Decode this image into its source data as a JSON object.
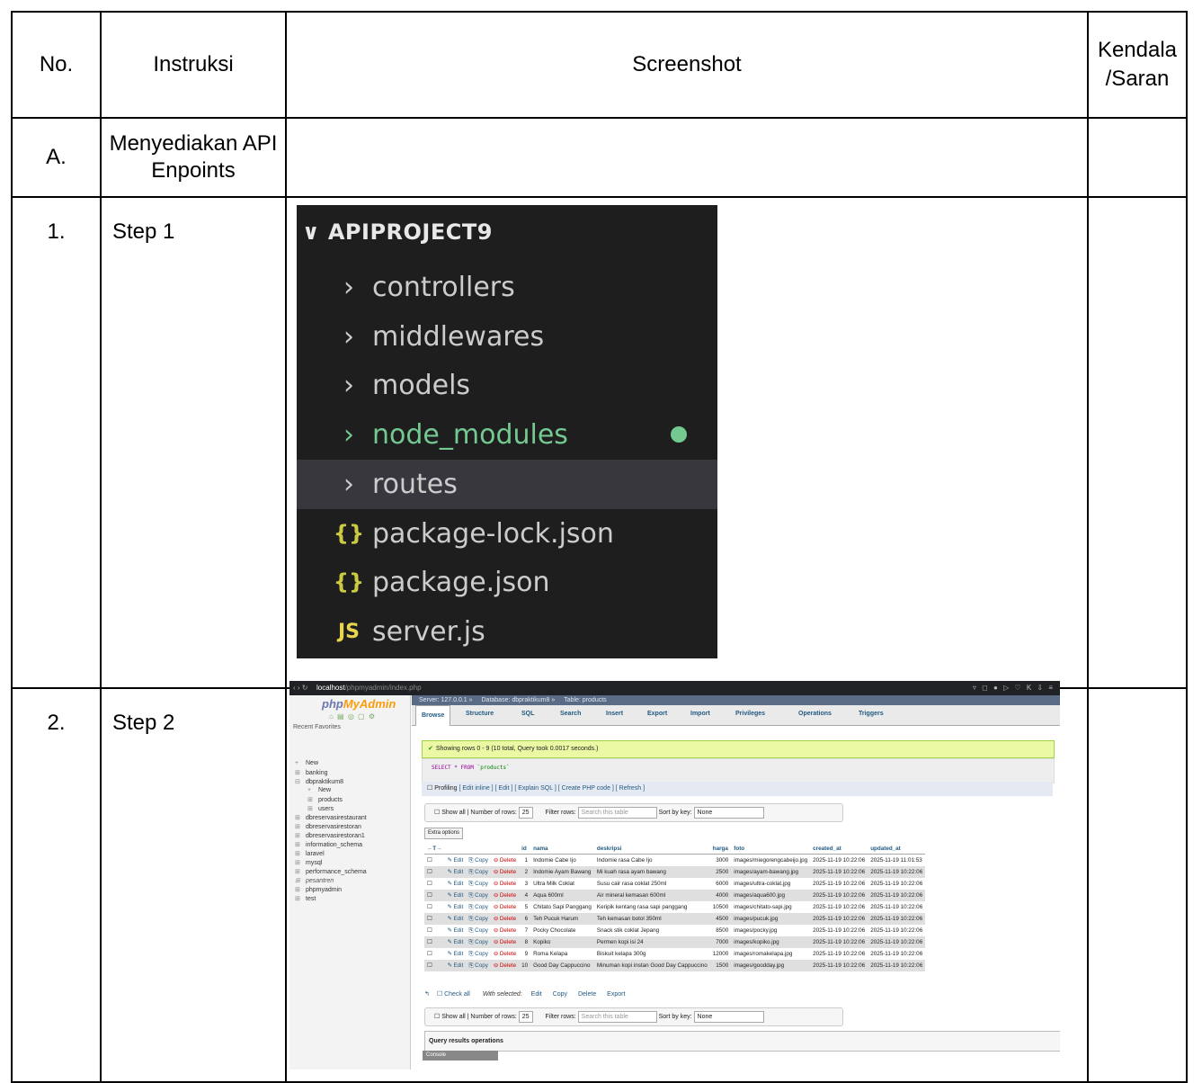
{
  "table": {
    "headers": {
      "no": "No.",
      "instruksi": "Instruksi",
      "screenshot": "Screenshot",
      "kendala_1": "Kendala",
      "kendala_2": "/Saran"
    },
    "section": {
      "no": "A.",
      "instruksi": "Menyediakan API Enpoints"
    },
    "rows": [
      {
        "no": "1.",
        "instruksi": "Step 1"
      },
      {
        "no": "2.",
        "instruksi": "Step 2"
      }
    ]
  },
  "explorer": {
    "project": "APIPROJECT9",
    "items": [
      {
        "name": "controllers",
        "icon": "chevron-right-icon"
      },
      {
        "name": "middlewares",
        "icon": "chevron-right-icon"
      },
      {
        "name": "models",
        "icon": "chevron-right-icon"
      },
      {
        "name": "node_modules",
        "icon": "chevron-right-icon",
        "color": "#73c991"
      },
      {
        "name": "routes",
        "icon": "chevron-right-icon",
        "selected": true
      },
      {
        "name": "package-lock.json",
        "icon": "json-icon"
      },
      {
        "name": "package.json",
        "icon": "json-icon"
      },
      {
        "name": "server.js",
        "icon": "js-icon"
      }
    ],
    "glyphs": {
      "chevron": "›",
      "json": "{}",
      "js": "JS",
      "down": "∨"
    }
  },
  "pma": {
    "url_host": "localhost",
    "url_path": "/phpmyadmin/index.php",
    "logo_a": "php",
    "logo_b": "MyAdmin",
    "side_tabs": "Recent  Favorites",
    "databases": [
      "New",
      "banking",
      "dbpraktikum8",
      "New",
      "products",
      "users",
      "dbreservasirestaurant",
      "dbreservasirestoran",
      "dbreservasirestoran1",
      "information_schema",
      "laravel",
      "mysql",
      "performance_schema",
      "pesantren",
      "phpmyadmin",
      "test"
    ],
    "breadcrumb": [
      "Server: 127.0.0.1",
      "Database: dbpraktikum8",
      "Table: products"
    ],
    "tabs": [
      "Browse",
      "Structure",
      "SQL",
      "Search",
      "Insert",
      "Export",
      "Import",
      "Privileges",
      "Operations",
      "Triggers"
    ],
    "success": "Showing rows 0 - 9 (10 total, Query took 0.0017 seconds.)",
    "sql_kw": "SELECT * FROM",
    "sql_table": "`products`",
    "profiling": "Profiling",
    "profiling_links": "[ Edit inline ] [ Edit ] [ Explain SQL ] [ Create PHP code ] [ Refresh ]",
    "nav": {
      "show_all": "Show all",
      "num_rows": "Number of rows:",
      "num_val": "25",
      "filter": "Filter rows:",
      "filter_ph": "Search this table",
      "sort": "Sort by key:",
      "sort_val": "None"
    },
    "extra_options": "Extra options",
    "columns": [
      "id",
      "nama",
      "deskripsi",
      "harga",
      "foto",
      "created_at",
      "updated_at"
    ],
    "actions": {
      "edit": "Edit",
      "copy": "Copy",
      "delete": "Delete"
    },
    "rows": [
      [
        "1",
        "Indomie Cabe Ijo",
        "Indomie rasa Cabe Ijo",
        "3000",
        "images/miegorengcabeijo.jpg",
        "2025-11-19 10:22:06",
        "2025-11-19 11:01:53"
      ],
      [
        "2",
        "Indomie Ayam Bawang",
        "Mi kuah rasa ayam bawang",
        "2500",
        "images/ayam-bawang.jpg",
        "2025-11-19 10:22:06",
        "2025-11-19 10:22:06"
      ],
      [
        "3",
        "Ultra Milk Coklat",
        "Susu cair rasa coklat 250ml",
        "6000",
        "images/ultra-coklat.jpg",
        "2025-11-19 10:22:06",
        "2025-11-19 10:22:06"
      ],
      [
        "4",
        "Aqua 600ml",
        "Air mineral kemasan 600ml",
        "4000",
        "images/aqua600.jpg",
        "2025-11-19 10:22:06",
        "2025-11-19 10:22:06"
      ],
      [
        "5",
        "Chitato Sapi Panggang",
        "Keripik kentang rasa sapi panggang",
        "10500",
        "images/chitato-sapi.jpg",
        "2025-11-19 10:22:06",
        "2025-11-19 10:22:06"
      ],
      [
        "6",
        "Teh Pucuk Harum",
        "Teh kemasan botol 350ml",
        "4500",
        "images/pucuk.jpg",
        "2025-11-19 10:22:06",
        "2025-11-19 10:22:06"
      ],
      [
        "7",
        "Pocky Chocolate",
        "Snack stik coklat Jepang",
        "8500",
        "images/pocky.jpg",
        "2025-11-19 10:22:06",
        "2025-11-19 10:22:06"
      ],
      [
        "8",
        "Kopiko",
        "Permen kopi isi 24",
        "7000",
        "images/kopiko.jpg",
        "2025-11-19 10:22:06",
        "2025-11-19 10:22:06"
      ],
      [
        "9",
        "Roma Kelapa",
        "Biskuit kelapa 300g",
        "12000",
        "images/romakelapa.jpg",
        "2025-11-19 10:22:06",
        "2025-11-19 10:22:06"
      ],
      [
        "10",
        "Good Day Cappuccino",
        "Minuman kopi instan Good Day Cappuccino",
        "1500",
        "images/goodday.jpg",
        "2025-11-19 10:22:06",
        "2025-11-19 10:22:06"
      ]
    ],
    "footer": {
      "check_all": "Check all",
      "with_selected": "With selected:",
      "edit": "Edit",
      "copy": "Copy",
      "delete": "Delete",
      "export": "Export"
    },
    "query_ops": "Query results operations",
    "console": "Console",
    "colors": {
      "link": "#235a81",
      "success_bg": "#ebf8a4",
      "row_even": "#dfdfdf"
    }
  }
}
